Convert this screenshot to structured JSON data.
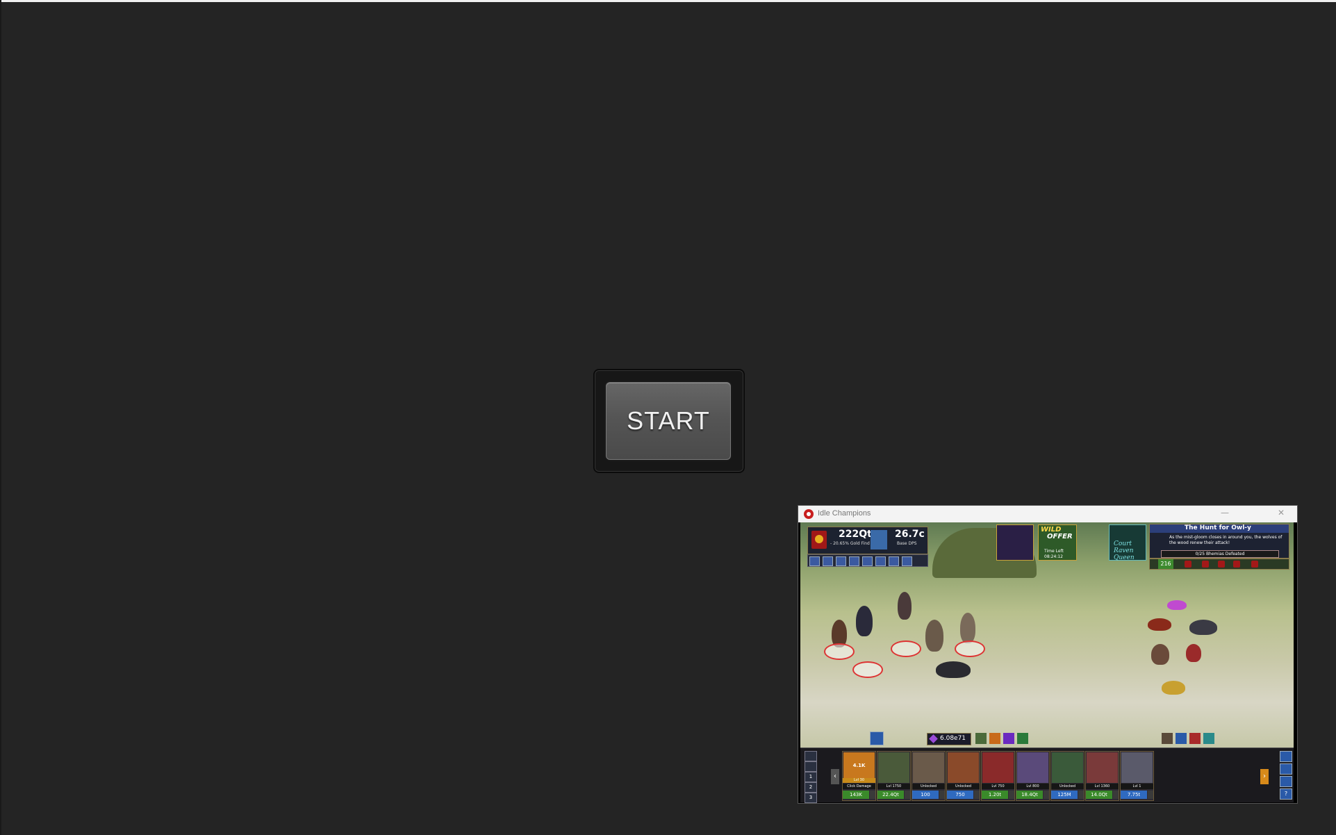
{
  "start_button": {
    "label": "START"
  },
  "game_window": {
    "title": "Idle Champions",
    "controls": {
      "minimize": "—",
      "close": "✕"
    },
    "hud": {
      "gold": {
        "value": "222Qt",
        "sub": "- 20.65% Gold Find"
      },
      "dps": {
        "value": "26.7c",
        "sub": "Base DPS"
      },
      "offer": {
        "line1": "WILD",
        "line2": "OFFER",
        "time_label": "Time Left",
        "time_value": "08:24:12"
      },
      "event": {
        "text": "Court Raven Queen"
      },
      "quest": {
        "title": "The Hunt for Owl-y",
        "description": "As the mist-gloom closes in around you, the wolves of the wood renew their attack!",
        "progress": "0/25 Bhemias Defeated"
      },
      "area_level": "216"
    },
    "gems": "6.08e71",
    "bench_buttons": [
      "1",
      "2",
      "3"
    ],
    "champions": [
      {
        "label": "Click Damage",
        "top": "4.1K",
        "level": "Lvl 30",
        "cost": "143K",
        "color": "#3a8a2a",
        "art": "#c8781e"
      },
      {
        "label": "Lvl 1750",
        "cost": "22.4Qt",
        "color": "#3a8a2a",
        "art": "#4a5a3a"
      },
      {
        "label": "Unlocked",
        "cost": "100",
        "color": "#2f6ac0",
        "art": "#6a5a4a"
      },
      {
        "label": "Unlocked",
        "cost": "750",
        "color": "#2f6ac0",
        "art": "#8a4a2a"
      },
      {
        "label": "Lvl 750",
        "cost": "1.20t",
        "color": "#3a8a2a",
        "art": "#8a2a2a"
      },
      {
        "label": "Lvl 800",
        "cost": "18.4Qt",
        "color": "#3a8a2a",
        "art": "#5a4a7a"
      },
      {
        "label": "Unlocked",
        "cost": "125M",
        "color": "#2f6ac0",
        "art": "#3a5a3a"
      },
      {
        "label": "Lvl 1360",
        "cost": "14.0Qt",
        "color": "#3a8a2a",
        "art": "#7a3a3a"
      },
      {
        "label": "Lvl 1",
        "cost": "7.75t",
        "color": "#2f6ac0",
        "art": "#5a5a6a"
      }
    ]
  }
}
